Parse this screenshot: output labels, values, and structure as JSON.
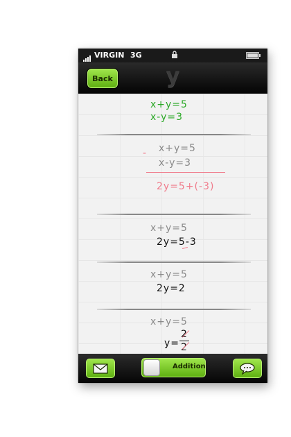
{
  "status_bar": {
    "carrier": "VIRGIN",
    "network": "3G"
  },
  "nav_bar": {
    "back_label": "Back",
    "title": "y"
  },
  "steps": [
    {
      "line1": "x+y=5",
      "line2": "x-y=3"
    },
    {
      "line1": "x+y=5",
      "line2": "x-y=3",
      "minus_mark": "-",
      "result": "2y=5+(-3)"
    },
    {
      "line1": "x+y=5",
      "line2": "2y=5-3"
    },
    {
      "line1": "x+y=5",
      "line2": "2y=2"
    },
    {
      "line1": "x+y=5",
      "line2_prefix": "y=",
      "numerator": "2",
      "denominator": "2"
    }
  ],
  "toolbar": {
    "mode_label": "Addition"
  },
  "colors": {
    "accent_green": "#6fc21e",
    "equation_green": "#2aa826",
    "annotation_pink": "#f07a8a"
  },
  "icons": {
    "mail": "envelope-icon",
    "chat": "speech-bubble-icon",
    "lock": "lock-icon"
  }
}
